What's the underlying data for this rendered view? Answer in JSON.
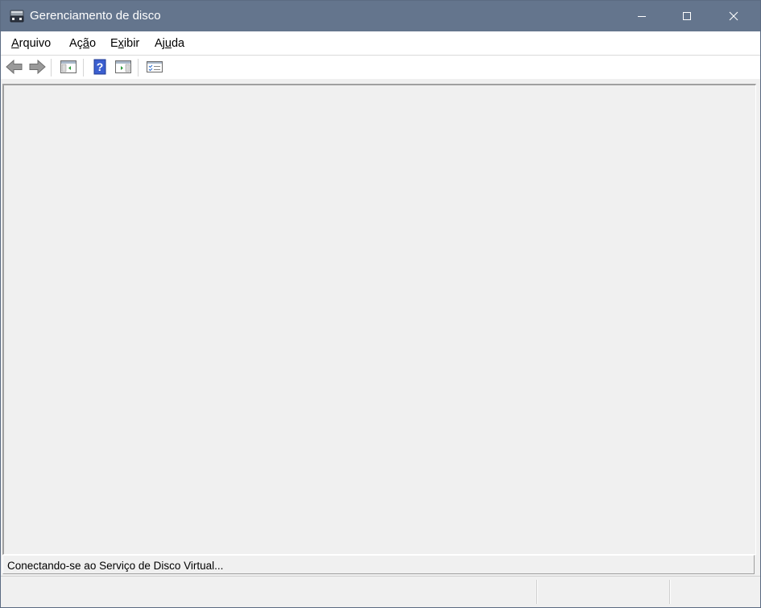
{
  "window": {
    "title": "Gerenciamento de disco",
    "icon": "disk-management-icon"
  },
  "titlebar_buttons": {
    "minimize": "minimize-icon",
    "maximize": "maximize-icon",
    "close": "close-icon"
  },
  "menu": {
    "items": [
      {
        "pre": "",
        "u": "A",
        "post": "rquivo"
      },
      {
        "pre": "Aç",
        "u": "ã",
        "post": "o"
      },
      {
        "pre": "E",
        "u": "x",
        "post": "ibir"
      },
      {
        "pre": "Aj",
        "u": "u",
        "post": "da"
      }
    ]
  },
  "toolbar": {
    "buttons": [
      "back-arrow-icon",
      "forward-arrow-icon",
      "show-hide-console-tree-icon",
      "help-icon",
      "show-hide-action-pane-icon",
      "properties-icon"
    ]
  },
  "status": {
    "message": "Conectando-se ao Serviço de Disco Virtual..."
  },
  "colors": {
    "titlebar": "#64758d",
    "client": "#f0f0f0",
    "menubar": "#ffffff"
  }
}
